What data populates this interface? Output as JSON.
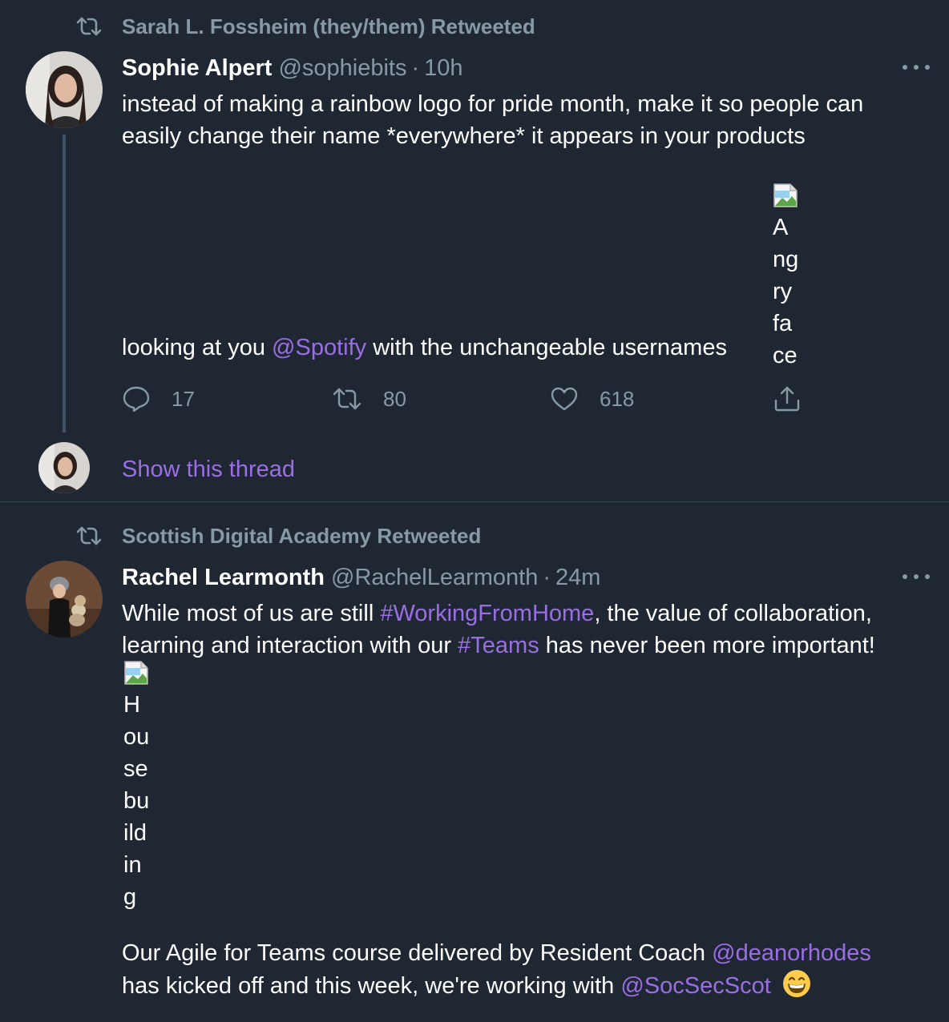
{
  "tweets": [
    {
      "retweeted_by": "Sarah L. Fossheim (they/them) Retweeted",
      "author_name": "Sophie Alpert",
      "author_handle": "@sophiebits",
      "separator": "·",
      "time": "10h",
      "text_line1": "instead of making a rainbow logo for pride month, make it so people can",
      "text_line2": "easily change their name *everywhere* it appears in your products",
      "text_line3_before": "looking at you",
      "mention": "@Spotify",
      "text_line3_after": "with the unchangeable usernames",
      "broken_image_alt_lines": [
        "A",
        "ng",
        "ry",
        "fa",
        "ce"
      ],
      "reply_count": "17",
      "retweet_count": "80",
      "like_count": "618",
      "show_thread": "Show this thread"
    },
    {
      "retweeted_by": "Scottish Digital Academy Retweeted",
      "author_name": "Rachel Learmonth",
      "author_handle": "@RachelLearmonth",
      "separator": "·",
      "time": "24m",
      "line1_before": "While most of us are still",
      "hashtag1": "#WorkingFromHome",
      "line1_after": ", the value of collaboration,",
      "line2_before": "learning and interaction with our",
      "hashtag2": "#Teams",
      "line2_after": "has never been more important!",
      "broken_image_alt_lines": [
        "H",
        "ou",
        "se",
        "bu",
        "ild",
        "in",
        "g"
      ],
      "line3_before": "Our Agile for Teams course delivered by Resident Coach",
      "mention1": "@deanorhodes",
      "line4_before": "has kicked off and this week, we're working with",
      "mention2": "@SocSecScot"
    }
  ],
  "colors": {
    "background": "#1e2732",
    "muted": "#8899a6",
    "link": "#9b6ee6",
    "divider": "#38444d"
  }
}
